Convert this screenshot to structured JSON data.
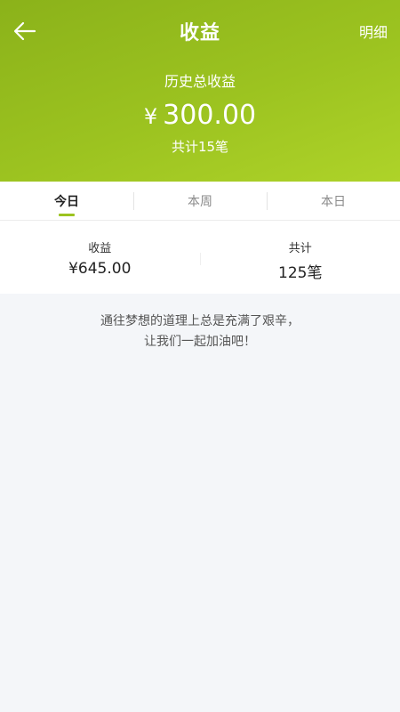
{
  "header": {
    "title": "收益",
    "detail_label": "明细",
    "back_icon": "arrow-left-icon"
  },
  "summary": {
    "label": "历史总收益",
    "currency": "¥",
    "amount": "300.00",
    "count": "共计15笔"
  },
  "tabs": [
    {
      "label": "今日",
      "active": true
    },
    {
      "label": "本周",
      "active": false
    },
    {
      "label": "本日",
      "active": false
    }
  ],
  "stats": {
    "income_label": "收益",
    "income_value": "¥645.00",
    "total_label": "共计",
    "total_value": "125笔"
  },
  "motto": {
    "line1": "通往梦想的道理上总是充满了艰辛，",
    "line2": "让我们一起加油吧！"
  },
  "colors": {
    "accent": "#9cc320",
    "background": "#f4f6f9"
  }
}
